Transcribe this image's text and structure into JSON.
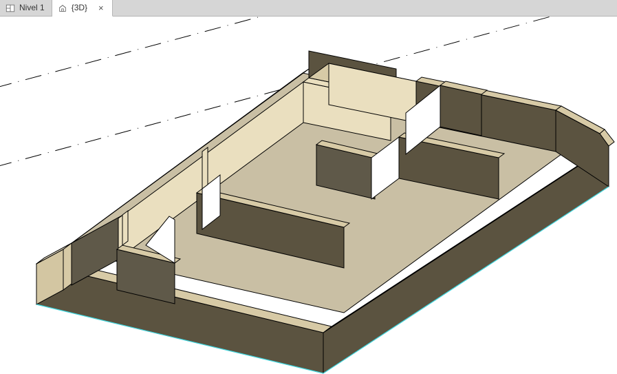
{
  "tabs": [
    {
      "label": "Nivel 1",
      "active": false,
      "closeable": false
    },
    {
      "label": "{3D}",
      "active": true,
      "closeable": true
    }
  ],
  "close_glyph": "×"
}
